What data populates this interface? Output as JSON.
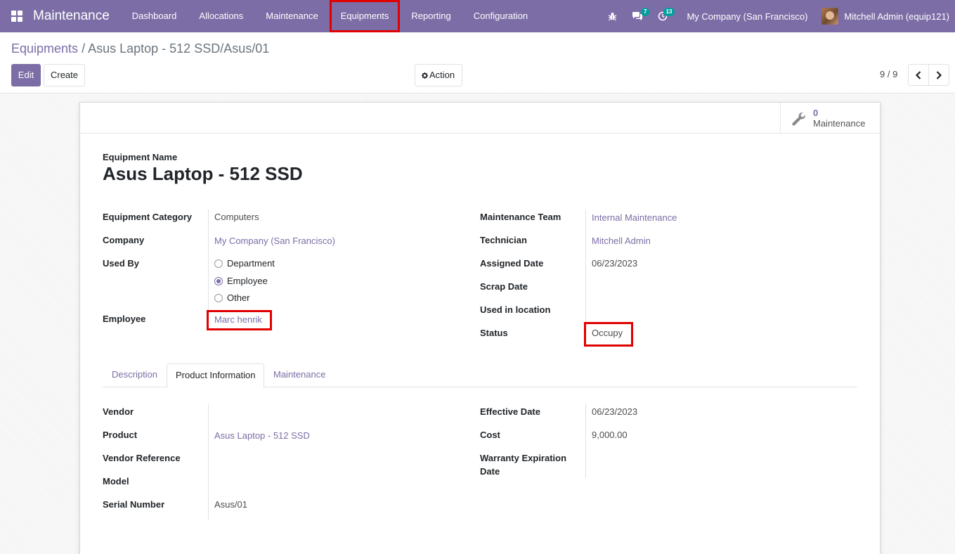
{
  "navbar": {
    "app_name": "Maintenance",
    "menu": [
      "Dashboard",
      "Allocations",
      "Maintenance",
      "Equipments",
      "Reporting",
      "Configuration"
    ],
    "chat_badge": "7",
    "activity_badge": "13",
    "company": "My Company (San Francisco)",
    "user": "Mitchell Admin (equip121)"
  },
  "control_panel": {
    "breadcrumb_parent": "Equipments",
    "breadcrumb_current": "Asus Laptop - 512 SSD/Asus/01",
    "edit_label": "Edit",
    "create_label": "Create",
    "action_label": "Action",
    "pager": "9 / 9"
  },
  "smart_button": {
    "value": "0",
    "label": "Maintenance"
  },
  "form": {
    "name_label": "Equipment Name",
    "name": "Asus Laptop - 512 SSD",
    "left": {
      "category_label": "Equipment Category",
      "category": "Computers",
      "company_label": "Company",
      "company": "My Company (San Francisco)",
      "used_by_label": "Used By",
      "used_by_options": [
        "Department",
        "Employee",
        "Other"
      ],
      "used_by_selected": "Employee",
      "employee_label": "Employee",
      "employee": "Marc henrik"
    },
    "right": {
      "team_label": "Maintenance Team",
      "team": "Internal Maintenance",
      "technician_label": "Technician",
      "technician": "Mitchell Admin",
      "assigned_label": "Assigned Date",
      "assigned": "06/23/2023",
      "scrap_label": "Scrap Date",
      "location_label": "Used in location",
      "status_label": "Status",
      "status": "Occupy"
    }
  },
  "tabs": [
    "Description",
    "Product Information",
    "Maintenance"
  ],
  "active_tab": "Product Information",
  "product_info": {
    "vendor_label": "Vendor",
    "product_label": "Product",
    "product": "Asus Laptop - 512 SSD",
    "vendor_ref_label": "Vendor Reference",
    "model_label": "Model",
    "serial_label": "Serial Number",
    "serial": "Asus/01",
    "effective_label": "Effective Date",
    "effective": "06/23/2023",
    "cost_label": "Cost",
    "cost": "9,000.00",
    "warranty_label_1": "Warranty Expiration",
    "warranty_label_2": "Date"
  },
  "colors": {
    "brand": "#7c6da6",
    "highlight": "#e00000",
    "badge": "#00a09d"
  }
}
